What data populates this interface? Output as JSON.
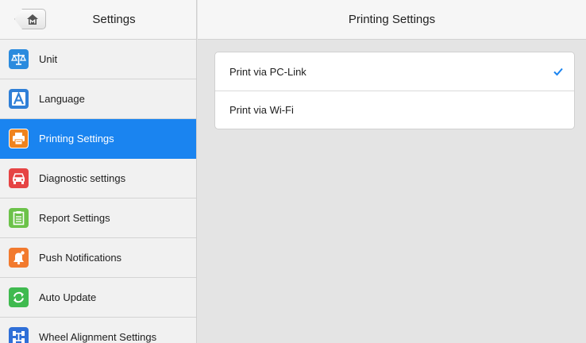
{
  "colors": {
    "accent": "#1a84f0",
    "checkmark": "#1a84f0",
    "background": "#e4e4e4"
  },
  "sidebar": {
    "title": "Settings",
    "home_icon": "home-icon",
    "items": [
      {
        "label": "Unit",
        "icon": "balance-scale-icon",
        "active": false
      },
      {
        "label": "Language",
        "icon": "letter-a-icon",
        "active": false
      },
      {
        "label": "Printing Settings",
        "icon": "printer-icon",
        "active": true
      },
      {
        "label": "Diagnostic settings",
        "icon": "car-icon",
        "active": false
      },
      {
        "label": "Report Settings",
        "icon": "clipboard-icon",
        "active": false
      },
      {
        "label": "Push Notifications",
        "icon": "bell-icon",
        "active": false
      },
      {
        "label": "Auto Update",
        "icon": "refresh-icon",
        "active": false
      },
      {
        "label": "Wheel Alignment Settings",
        "icon": "wheel-alignment-icon",
        "active": false
      }
    ]
  },
  "main": {
    "title": "Printing Settings",
    "options": [
      {
        "label": "Print via PC-Link",
        "selected": true
      },
      {
        "label": "Print via Wi-Fi",
        "selected": false
      }
    ]
  }
}
